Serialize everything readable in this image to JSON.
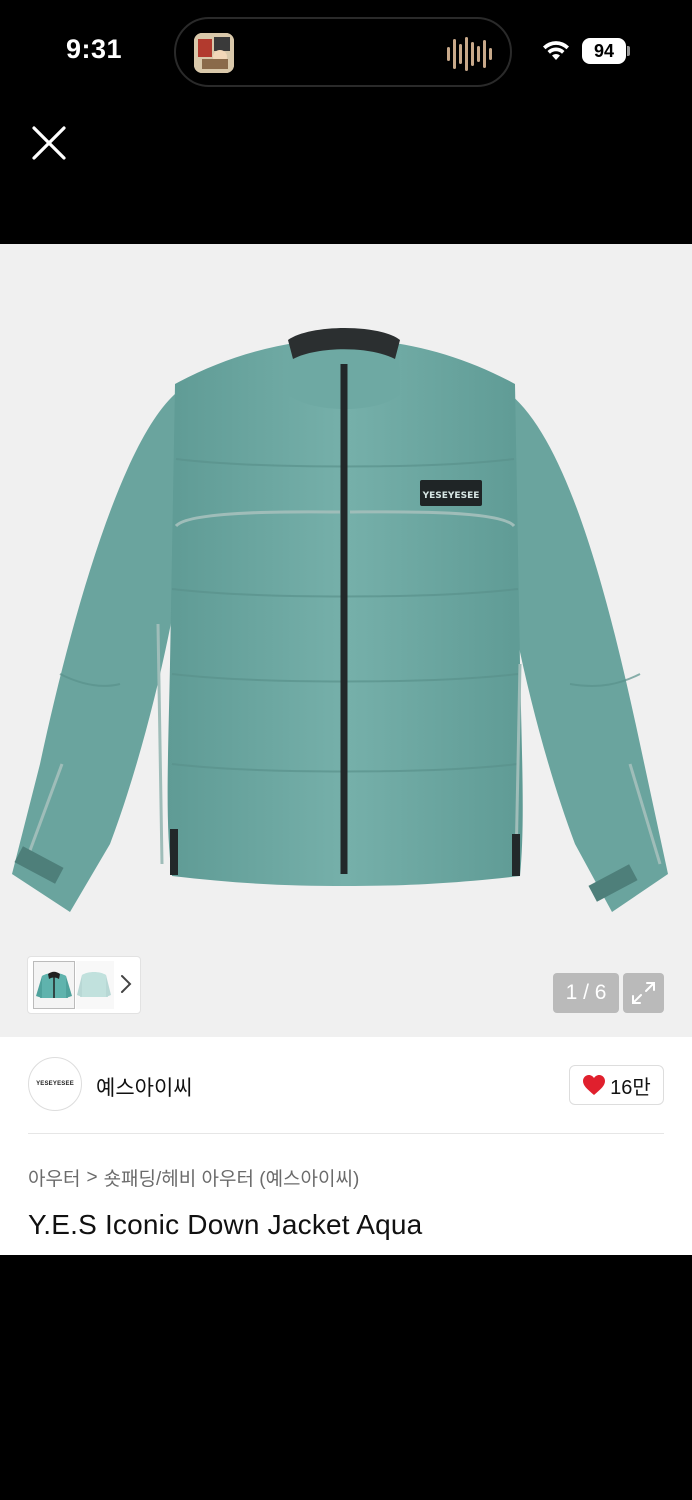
{
  "status_bar": {
    "time": "9:31",
    "battery": "94"
  },
  "gallery": {
    "counter": "1 / 6",
    "jacket_logo_text": "YESEYESEE"
  },
  "shop": {
    "logo_text": "YESEYESEE",
    "name": "예스아이씨",
    "likes": "16만",
    "like_color": "#e0202d"
  },
  "breadcrumb": {
    "category": "아우터",
    "separator": ">",
    "subcategory": "숏패딩/헤비 아우터 (예스아이씨)"
  },
  "product": {
    "title": "Y.E.S Iconic Down Jacket Aqua"
  },
  "colors": {
    "jacket_aqua": "#6fa8a2",
    "background": "#000000",
    "image_bg": "#f0f0f0"
  }
}
